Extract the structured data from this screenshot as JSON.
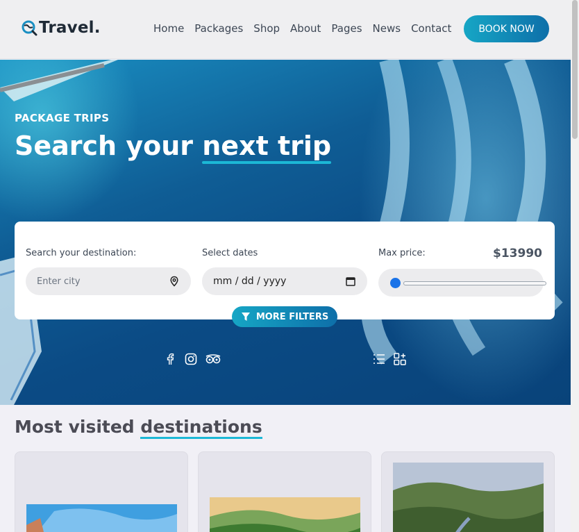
{
  "header": {
    "logo_text": "Travel.",
    "nav": [
      "Home",
      "Packages",
      "Shop",
      "About",
      "Pages",
      "News",
      "Contact"
    ],
    "book_label": "BOOK NOW"
  },
  "hero": {
    "kicker": "PACKAGE TRIPS",
    "title_plain": "Search your ",
    "title_highlight": "next trip"
  },
  "search": {
    "destination_label": "Search your destination:",
    "destination_placeholder": "Enter city",
    "dates_label": "Select dates",
    "dates_value": "mm / dd / yyyy",
    "price_label": "Max price:",
    "price_value": "$13990",
    "price_slider_fraction": 0.0,
    "more_filters_label": "MORE FILTERS"
  },
  "destinations": {
    "title_plain": "Most visited ",
    "title_highlight": "destinations"
  },
  "colors": {
    "accent": "#1cb8d6",
    "button_gradient_start": "#16a6c5",
    "button_gradient_end": "#0e6fa9"
  }
}
